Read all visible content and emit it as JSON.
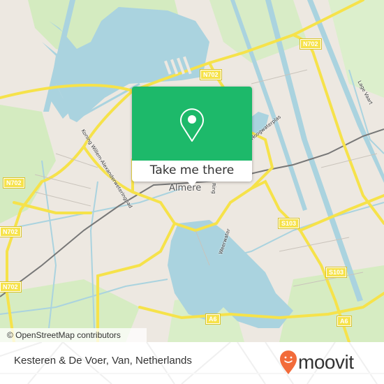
{
  "map": {
    "road_labels": [
      {
        "id": "n702-top-right",
        "text": "N702"
      },
      {
        "id": "n702-top",
        "text": "N702"
      },
      {
        "id": "n702-left-1",
        "text": "N702"
      },
      {
        "id": "n702-left-2",
        "text": "N702"
      },
      {
        "id": "n702-left-3",
        "text": "N702"
      },
      {
        "id": "s103-1",
        "text": "S103"
      },
      {
        "id": "s103-2",
        "text": "S103"
      },
      {
        "id": "a6-1",
        "text": "A6"
      },
      {
        "id": "a6-2",
        "text": "A6"
      }
    ],
    "street_labels": {
      "koning": "Koning Willem-Alexanderweteringpad",
      "weerwater": "Weerwater",
      "hoogwaterplas": "Hoogwaterplas",
      "lage_vaart": "Lage Vaart",
      "almere": "Almere",
      "ring": "Ring"
    },
    "attribution": "© OpenStreetMap contributors"
  },
  "popup": {
    "cta_label": "Take me there",
    "icon": "map-pin-icon"
  },
  "footer": {
    "address": "Kesteren & De Voer, Van, Netherlands",
    "brand": "moovit",
    "brand_color": "#f26b3a"
  },
  "colors": {
    "popup_green": "#1db96a",
    "water": "#aad3df",
    "road": "#f6e24a",
    "land": "#ede8e1",
    "park": "#cfe8b4"
  }
}
